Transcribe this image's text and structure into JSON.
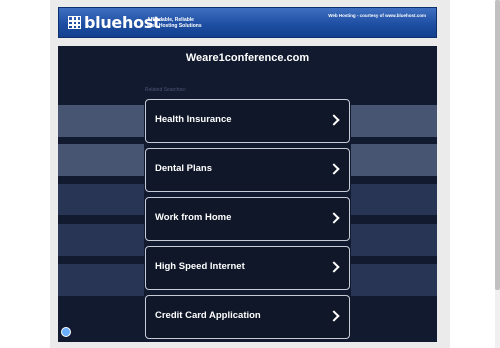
{
  "banner": {
    "logo_text": "bluehost",
    "tagline_line1": "Affordable, Reliable",
    "tagline_line2": "Web Hosting Solutions",
    "courtesy": "Web Hosting - courtesy of www.bluehost.com"
  },
  "main": {
    "domain": "Weare1conference.com",
    "related_label": "Related Searches:",
    "links": [
      {
        "label": "Health Insurance"
      },
      {
        "label": "Dental Plans"
      },
      {
        "label": "Work from Home"
      },
      {
        "label": "High Speed Internet"
      },
      {
        "label": "Credit Card Application"
      }
    ]
  },
  "colors": {
    "banner_blue": "#1e4fa3",
    "panel_bg": "#111a2e",
    "side_band": "#283555",
    "button_border": "#c7ccd6"
  },
  "icons": [
    "bluehost-logo-icon",
    "chevron-right-icon",
    "privacy-icon"
  ]
}
